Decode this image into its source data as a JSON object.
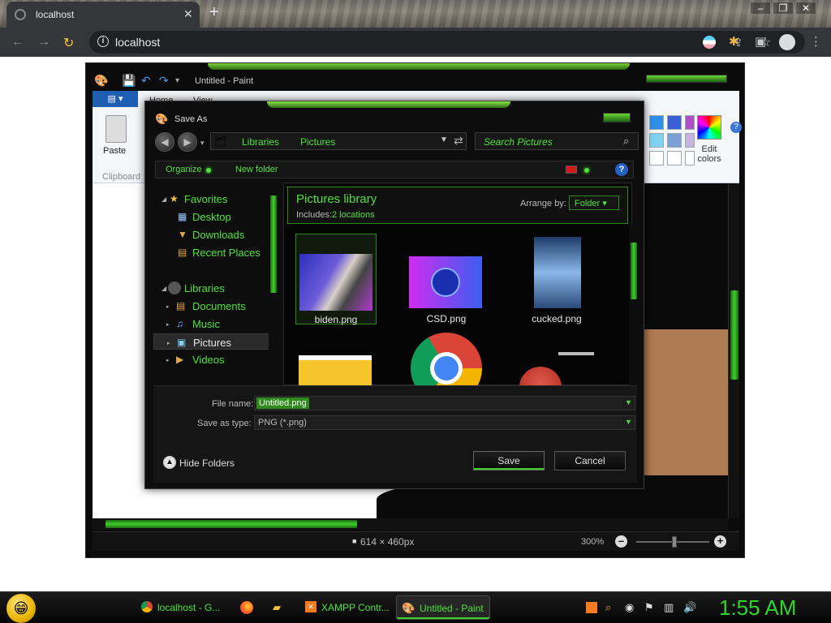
{
  "browser": {
    "tab_title": "localhost",
    "new_tab": "+",
    "close_tab": "✕",
    "url": "localhost",
    "window_controls": [
      "–",
      "❐",
      "✕"
    ]
  },
  "paint": {
    "title": "Untitled - Paint",
    "ribbon_tabs": [
      "Home",
      "View"
    ],
    "paste_label": "Paste",
    "clipboard_label": "Clipboard",
    "edit_colors_label": "Edit colors",
    "help": "?",
    "canvas_size": "614 × 460px",
    "zoom": "300%",
    "palette": [
      "#2f8fe8",
      "#3b5fd6",
      "#b04fc8",
      "#7fd3f0",
      "#7d9fd8",
      "#c8b4e0",
      "#ffffff",
      "#ffffff",
      "#ffffff"
    ]
  },
  "dialog": {
    "title": "Save As",
    "breadcrumb": [
      "Libraries",
      "Pictures"
    ],
    "search_placeholder": "Search Pictures",
    "organize": "Organize",
    "new_folder": "New folder",
    "nav": {
      "favorites": "Favorites",
      "desktop": "Desktop",
      "downloads": "Downloads",
      "recent": "Recent Places",
      "libraries": "Libraries",
      "documents": "Documents",
      "music": "Music",
      "pictures": "Pictures",
      "videos": "Videos"
    },
    "library_title": "Pictures library",
    "includes_label": "Includes:",
    "includes_value": "2 locations",
    "arrange_by": "Arrange by:",
    "arrange_value": "Folder",
    "files": [
      {
        "name": "biden.png"
      },
      {
        "name": "CSD.png"
      },
      {
        "name": "cucked.png"
      },
      {
        "name": ""
      },
      {
        "name": ""
      },
      {
        "name": ""
      }
    ],
    "file_name_label": "File name:",
    "file_name_value": "Untitled.png",
    "save_type_label": "Save as type:",
    "save_type_value": "PNG (*.png)",
    "hide_folders": "Hide Folders",
    "save": "Save",
    "cancel": "Cancel"
  },
  "taskbar": {
    "items": [
      "localhost - G...",
      "",
      "",
      "XAMPP Contr...",
      "Untitled - Paint"
    ],
    "clock": "1:55 AM"
  }
}
